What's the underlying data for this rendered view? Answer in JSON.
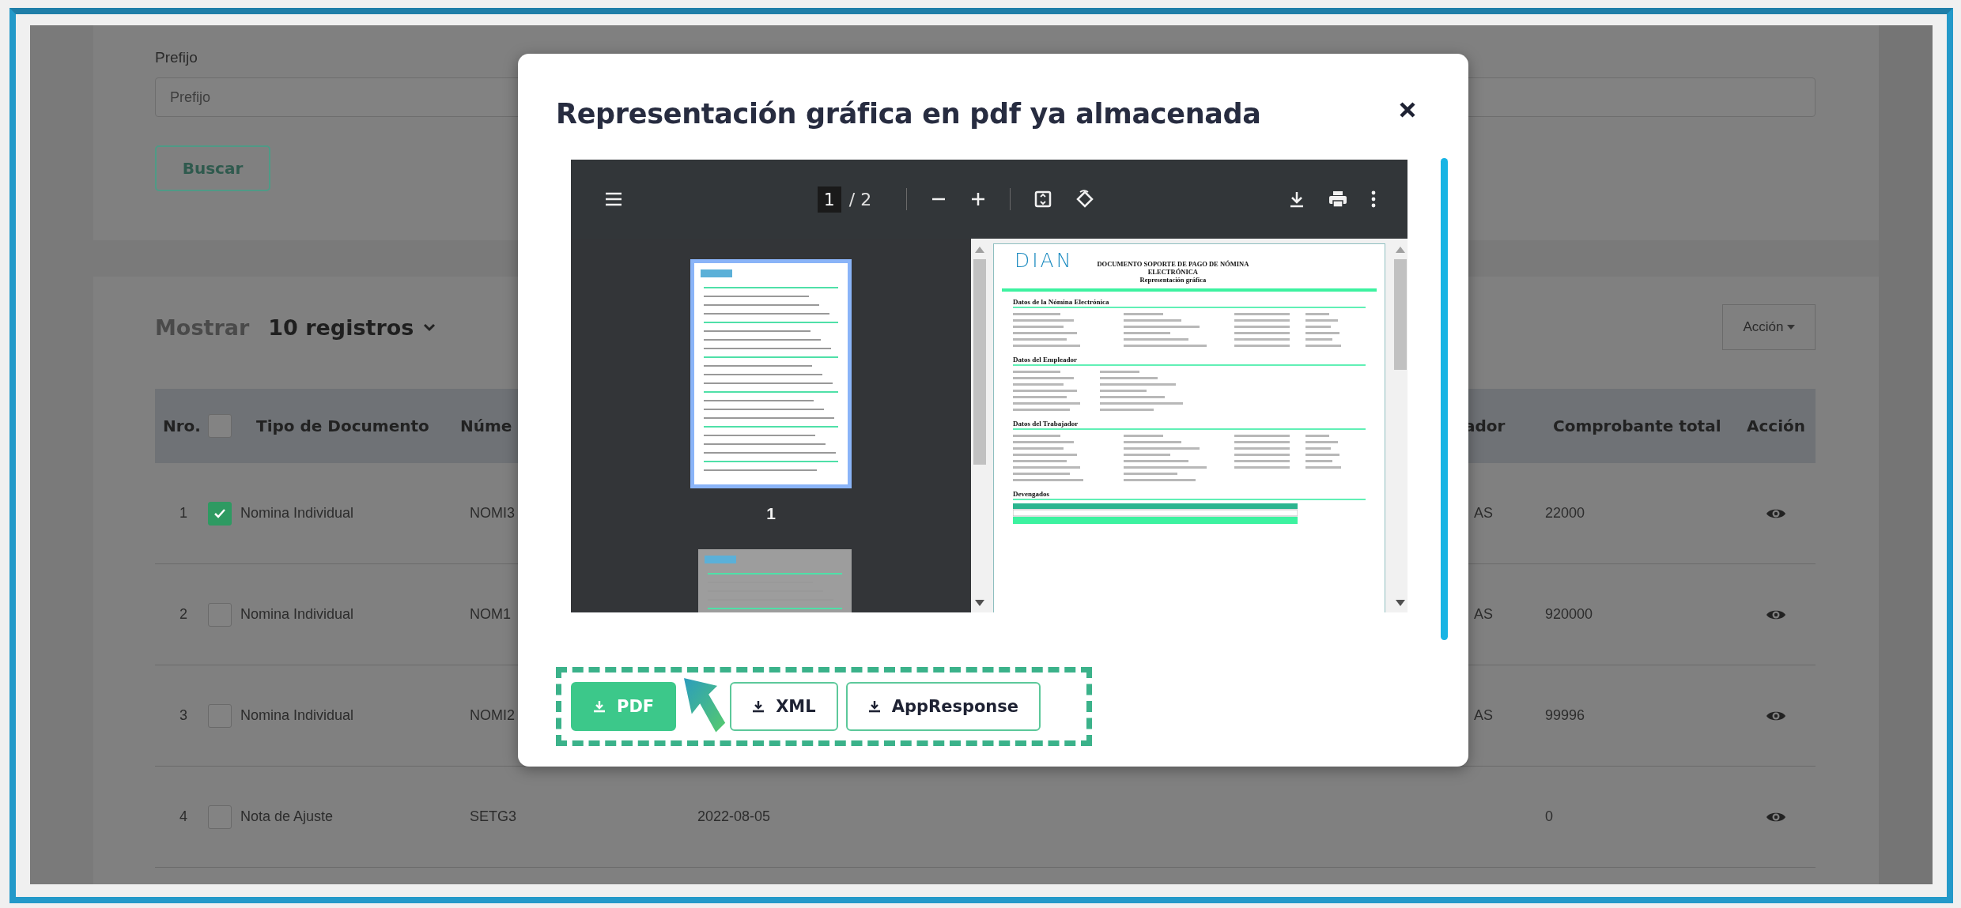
{
  "filter": {
    "label": "Prefijo",
    "placeholder": "Prefijo",
    "button": "Buscar"
  },
  "table_controls": {
    "show_label": "Mostrar",
    "page_size": "10 registros",
    "action_button": "Acción"
  },
  "table": {
    "header_checked": false,
    "columns": [
      "Nro.",
      "Tipo de Documento",
      "Núme",
      "ador",
      "Comprobante total",
      "Acción"
    ],
    "rows": [
      {
        "nro": "1",
        "checked": true,
        "tipo": "Nomina Individual",
        "numero": "NOMI3",
        "column_6": "AS",
        "total": "22000"
      },
      {
        "nro": "2",
        "checked": false,
        "tipo": "Nomina Individual",
        "numero": "NOM1",
        "column_6": "AS",
        "total": "920000"
      },
      {
        "nro": "3",
        "checked": false,
        "tipo": "Nomina Individual",
        "numero": "NOMI2",
        "column_6": "AS",
        "total": "99996"
      },
      {
        "nro": "4",
        "checked": false,
        "tipo": "Nota de Ajuste",
        "numero": "SETG3",
        "column_4": "2022-08-05",
        "total": "0"
      }
    ]
  },
  "modal": {
    "title": "Representación gráfica en pdf ya almacenada",
    "viewer": {
      "current_page": "1",
      "page_total": "/ 2",
      "thumbnails": [
        {
          "label": "1",
          "selected": true
        },
        {
          "selected": false
        }
      ],
      "page": {
        "logo": "DIAN",
        "title_lines": [
          "DOCUMENTO SOPORTE DE PAGO DE NÓMINA",
          "ELECTRÓNICA",
          "Representación gráfica"
        ],
        "sections": [
          {
            "heading": "Datos de la Nómina Electrónica"
          },
          {
            "heading": "Datos del Empleador"
          },
          {
            "heading": "Datos del Trabajador"
          },
          {
            "heading": "Devengados"
          }
        ]
      }
    },
    "buttons": [
      {
        "label": "PDF",
        "selected": true
      },
      {
        "label": "XML",
        "selected": false
      },
      {
        "label": "AppResponse",
        "selected": false
      }
    ]
  }
}
